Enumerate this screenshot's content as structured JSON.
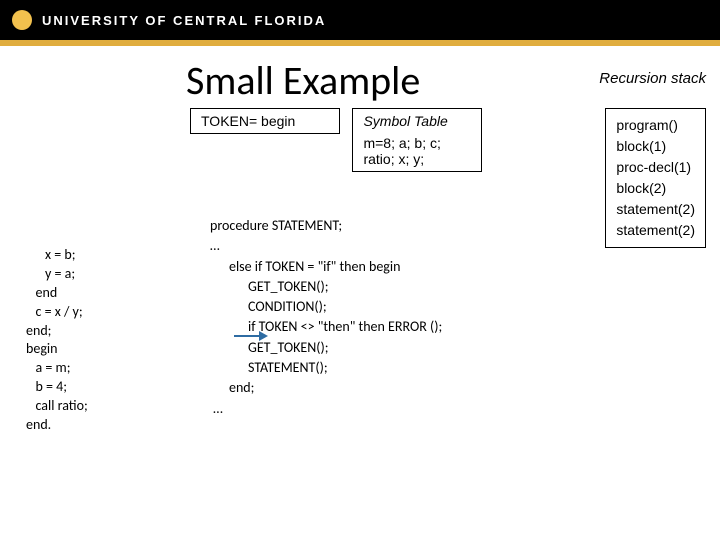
{
  "header": {
    "university": "UNIVERSITY OF CENTRAL FLORIDA"
  },
  "title": "Small Example",
  "token_box": {
    "label": "TOKEN= begin"
  },
  "symbol_box": {
    "label": "Symbol Table",
    "contents": "m=8; a; b; c; ratio; x; y;"
  },
  "recursion": {
    "label": "Recursion stack",
    "items": [
      "program()",
      "block(1)",
      "proc-decl(1)",
      "block(2)",
      "statement(2)",
      "statement(2)"
    ]
  },
  "code_left": "      x = b;\n      y = a;\n   end\n   c = x / y;\nend;\nbegin\n   a = m;\n   b = 4;\n   call ratio;\nend.",
  "procedure": "procedure STATEMENT;\n…\n      else if TOKEN = \"if\" then begin\n            GET_TOKEN();\n            CONDITION();\n            if TOKEN <> \"then\" then ERROR ();\n            GET_TOKEN();\n            STATEMENT();\n      end;\n …"
}
